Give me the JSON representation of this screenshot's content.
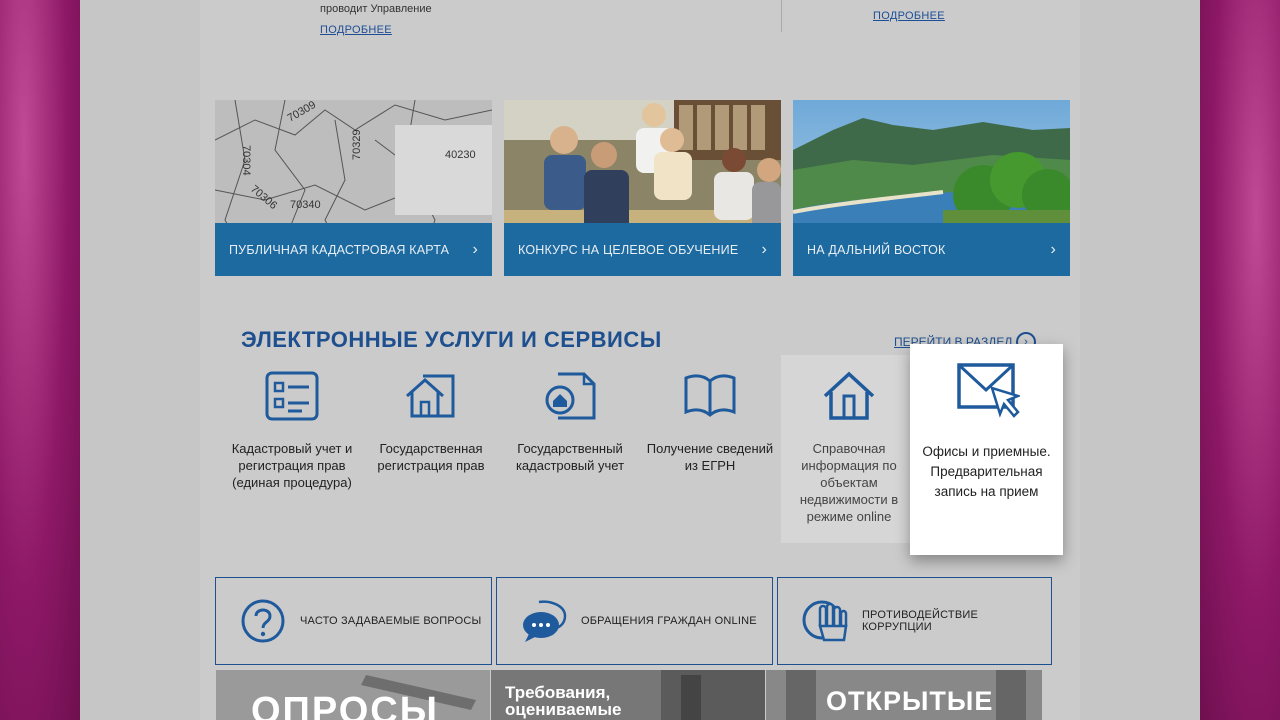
{
  "top": {
    "left_text": "проводит Управление",
    "left_more": "ПОДРОБНЕЕ",
    "right_more": "ПОДРОБНЕЕ"
  },
  "tiles": [
    {
      "label": "ПУБЛИЧНАЯ КАДАСТРОВАЯ КАРТА",
      "chevron": "›",
      "map_numbers": [
        "70309",
        "70304",
        "70329",
        "40230",
        "70306",
        "70340"
      ]
    },
    {
      "label": "КОНКУРС НА ЦЕЛЕВОЕ ОБУЧЕНИЕ",
      "chevron": "›"
    },
    {
      "label": "НА ДАЛЬНИЙ ВОСТОК",
      "chevron": "›"
    }
  ],
  "services_section": {
    "title": "ЭЛЕКТРОННЫЕ УСЛУГИ И СЕРВИСЫ",
    "goto_link": "ПЕРЕЙТИ В РАЗДЕЛ",
    "goto_icon": "›",
    "items": [
      {
        "icon": "form-icon",
        "label": "Кадастровый учет и регистрация прав (единая процедура)"
      },
      {
        "icon": "house-doc-icon",
        "label": "Государственная регистрация прав"
      },
      {
        "icon": "house-circle-doc-icon",
        "label": "Государственный кадастровый учет"
      },
      {
        "icon": "open-book-icon",
        "label": "Получение сведений из ЕГРН"
      },
      {
        "icon": "house-icon",
        "label": "Справочная информация по объектам недвижимости в режиме online"
      },
      {
        "icon": "envelope-cursor-icon",
        "label": "Офисы и приемные. Предварительная запись на прием"
      }
    ]
  },
  "quick_links": [
    {
      "icon": "question-icon",
      "label": "ЧАСТО ЗАДАВАЕМЫЕ ВОПРОСЫ"
    },
    {
      "icon": "chat-bubble-icon",
      "label": "ОБРАЩЕНИЯ ГРАЖДАН ONLINE"
    },
    {
      "icon": "hand-stop-icon",
      "label": "ПРОТИВОДЕЙСТВИЕ КОРРУПЦИИ"
    }
  ],
  "banners": [
    {
      "text": "ОПРОСЫ"
    },
    {
      "text_line1": "Требования,",
      "text_line2": "оцениваемые"
    },
    {
      "text": "ОТКРЫТЫЕ"
    }
  ],
  "colors": {
    "accent_blue": "#1e4f8f",
    "tile_bar": "#1c6aa0",
    "outer_magenta": "#a8237a"
  }
}
